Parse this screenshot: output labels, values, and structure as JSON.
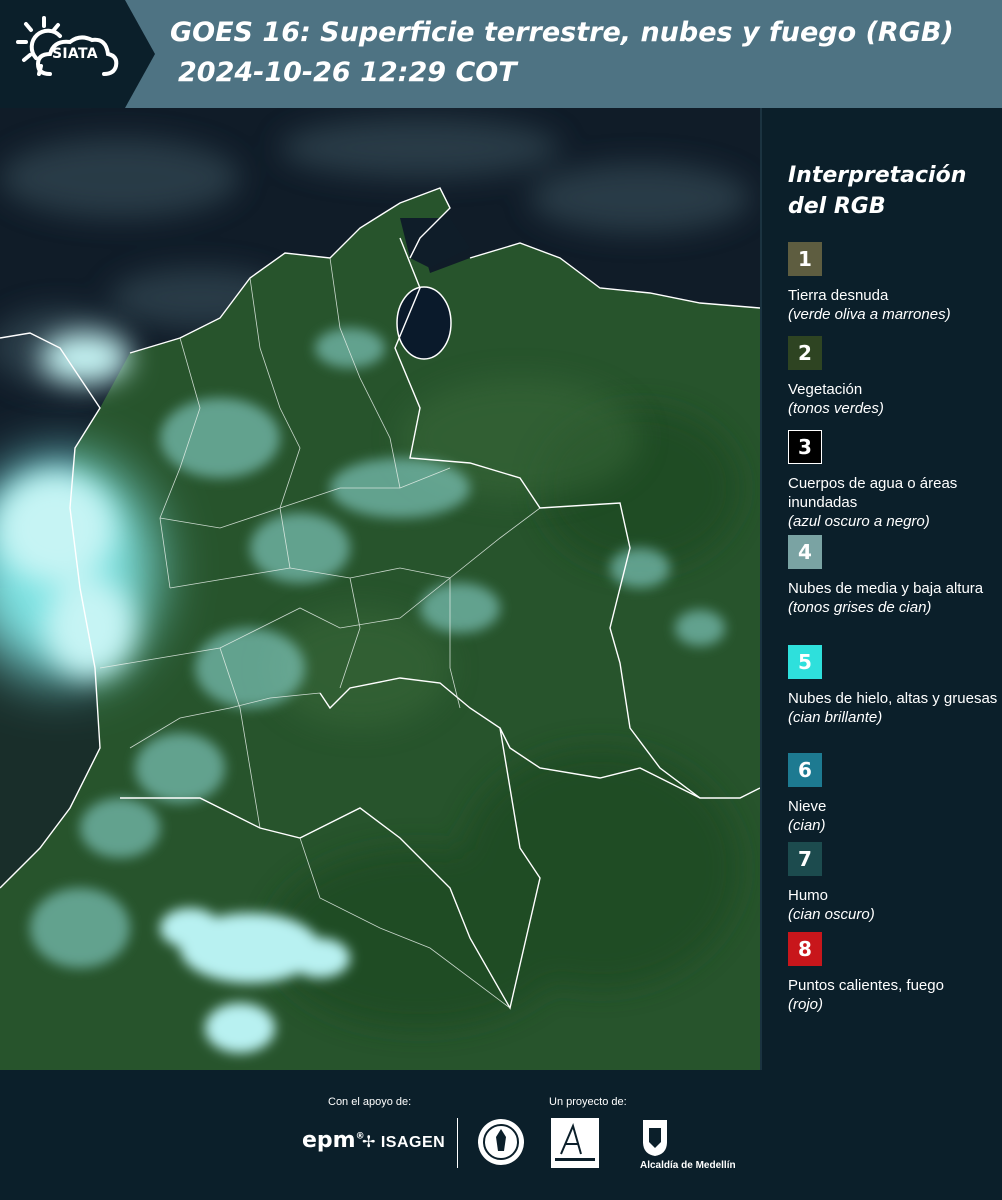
{
  "header": {
    "logo_text": "SIATA",
    "title": "GOES 16: Superficie terrestre, nubes y fuego (RGB)",
    "subtitle": "2024-10-26 12:29 COT"
  },
  "legend": {
    "title_line1": "Interpretación",
    "title_line2": "del RGB",
    "items": [
      {
        "number": "1",
        "color": "#5e5d40",
        "label": "Tierra desnuda",
        "note": "(verde oliva a marrones)"
      },
      {
        "number": "2",
        "color": "#2e4422",
        "label": "Vegetación",
        "note": "(tonos verdes)"
      },
      {
        "number": "3",
        "color": "#000000",
        "label": "Cuerpos de agua o áreas inundadas",
        "note": "(azul oscuro a negro)"
      },
      {
        "number": "4",
        "color": "#7aa3a3",
        "label": "Nubes de media y baja altura",
        "note": "(tonos grises de cian)"
      },
      {
        "number": "5",
        "color": "#2ee0dc",
        "label": "Nubes de hielo, altas y gruesas",
        "note": "(cian brillante)"
      },
      {
        "number": "6",
        "color": "#1d7a91",
        "label": "Nieve",
        "note": "(cian)"
      },
      {
        "number": "7",
        "color": "#1c4b4e",
        "label": "Humo",
        "note": "(cian oscuro)"
      },
      {
        "number": "8",
        "color": "#c8161b",
        "label": "Puntos calientes, fuego",
        "note": "(rojo)"
      }
    ]
  },
  "footer": {
    "support_caption": "Con el apoyo de:",
    "project_caption": "Un proyecto de:",
    "epm": "epm",
    "isagen": "ISAGEN",
    "alcaldia": "Alcaldía de Medellín"
  }
}
